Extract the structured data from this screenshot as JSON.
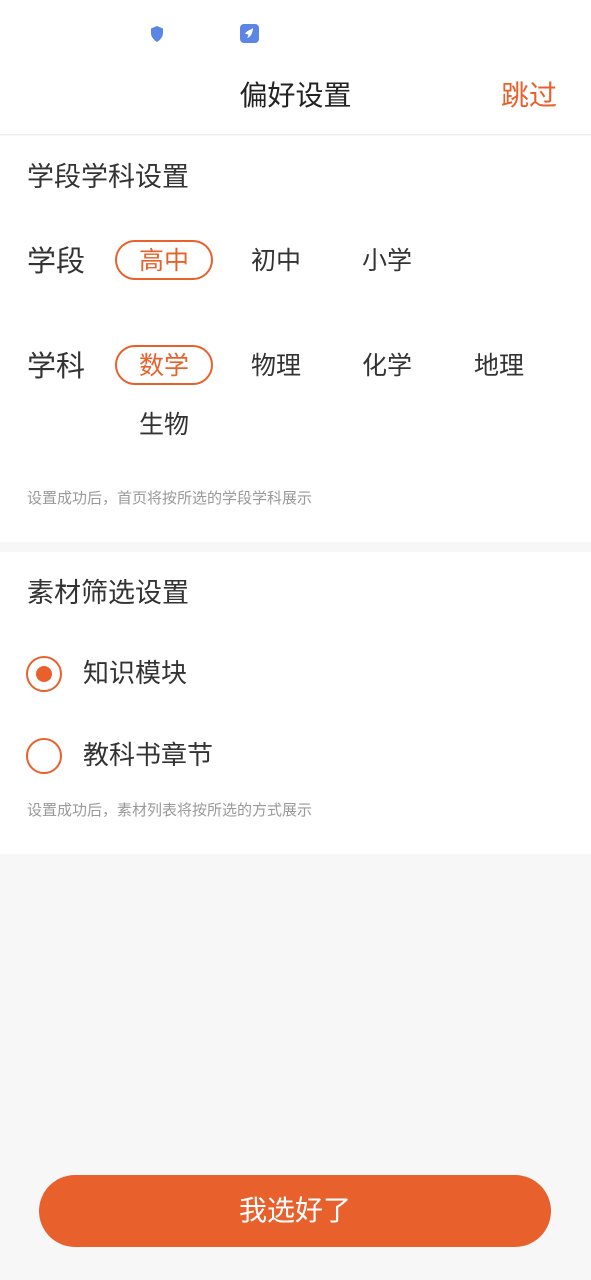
{
  "colors": {
    "accent": "#e8612d",
    "status_icon_blue": "#5b86e5",
    "hint": "#999999"
  },
  "status_bar": {
    "icons": [
      "shield-icon",
      "app-notification-icon"
    ]
  },
  "header": {
    "title": "偏好设置",
    "skip_label": "跳过"
  },
  "grade_subject": {
    "title": "学段学科设置",
    "grade_label": "学段",
    "grades": [
      {
        "label": "高中",
        "selected": true
      },
      {
        "label": "初中",
        "selected": false
      },
      {
        "label": "小学",
        "selected": false
      }
    ],
    "subject_label": "学科",
    "subjects": [
      {
        "label": "数学",
        "selected": true
      },
      {
        "label": "物理",
        "selected": false
      },
      {
        "label": "化学",
        "selected": false
      },
      {
        "label": "地理",
        "selected": false
      },
      {
        "label": "生物",
        "selected": false
      }
    ],
    "hint": "设置成功后，首页将按所选的学段学科展示"
  },
  "material_filter": {
    "title": "素材筛选设置",
    "options": [
      {
        "label": "知识模块",
        "selected": true
      },
      {
        "label": "教科书章节",
        "selected": false
      }
    ],
    "hint": "设置成功后，素材列表将按所选的方式展示"
  },
  "confirm_button": {
    "label": "我选好了"
  }
}
